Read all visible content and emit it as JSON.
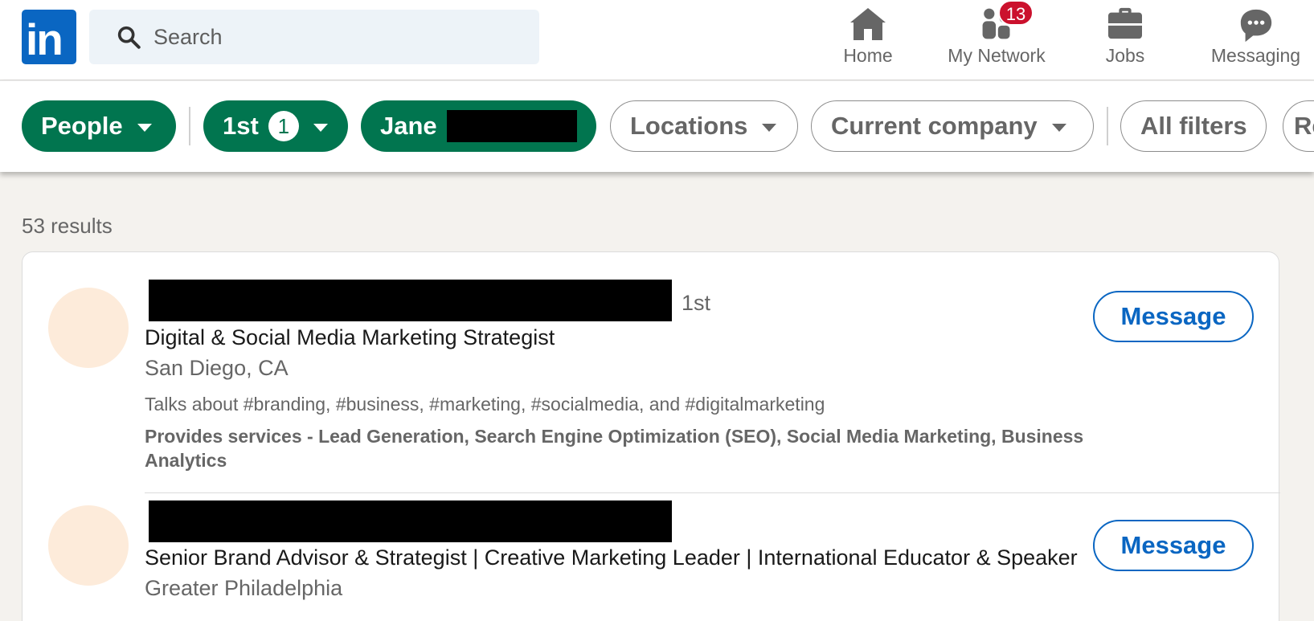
{
  "nav": {
    "search_placeholder": "Search",
    "items": [
      {
        "label": "Home",
        "icon": "home-icon"
      },
      {
        "label": "My Network",
        "icon": "network-icon",
        "badge": "13"
      },
      {
        "label": "Jobs",
        "icon": "briefcase-icon"
      },
      {
        "label": "Messaging",
        "icon": "messaging-icon"
      }
    ],
    "logo_text": "in",
    "brand_color": "#0a66c2"
  },
  "filters": {
    "people": "People",
    "first": "1st",
    "first_count": "1",
    "jane": "Jane",
    "locations": "Locations",
    "current_company": "Current company",
    "all_filters": "All filters",
    "reset": "Reset",
    "active_color": "#01754f"
  },
  "results": {
    "count_text": "53 results",
    "items": [
      {
        "degree": "1st",
        "headline": "Digital & Social Media Marketing Strategist",
        "location": "San Diego, CA",
        "talks_about": "Talks about #branding, #business, #marketing, #socialmedia, and #digitalmarketing",
        "services": "Provides services - Lead Generation, Search Engine Optimization (SEO), Social Media Marketing, Business Analytics",
        "action": "Message"
      },
      {
        "degree": "",
        "headline": "Senior Brand Advisor & Strategist | Creative Marketing Leader | International Educator & Speaker",
        "location": "Greater Philadelphia",
        "action": "Message"
      }
    ]
  }
}
